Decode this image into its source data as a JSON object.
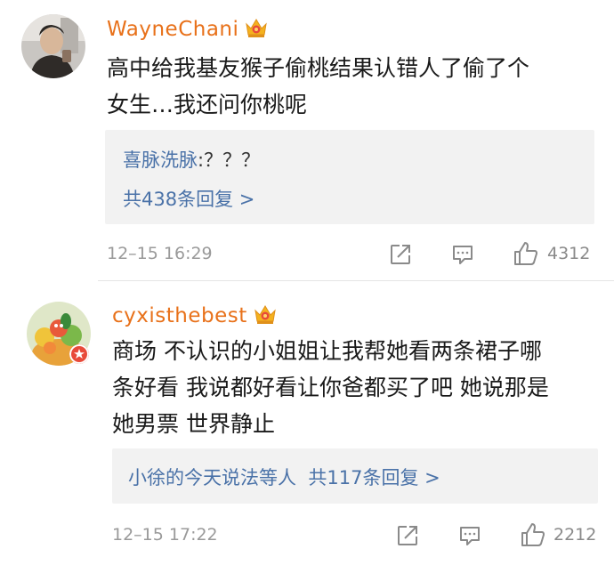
{
  "comments": [
    {
      "username": "WayneChani",
      "text": "高中给我基友猴子偷桃结果认错人了偷了个\n女生…我还问你桃呢",
      "reply_preview": {
        "author": "喜脉洗脉",
        "text": ":？？？"
      },
      "reply_count_label": "共438条回复 >",
      "timestamp": "12–15 16:29",
      "like_count": "4312",
      "icons": [
        "crown-icon",
        "share-icon",
        "comment-icon",
        "like-icon"
      ]
    },
    {
      "username": "cyxisthebest",
      "text": "商场 不认识的小姐姐让我帮她看两条裙子哪\n条好看 我说都好看让你爸都买了吧 她说那是\n她男票 世界静止",
      "reply_preview": {
        "summary": "小徐的今天说法等人",
        "count_label": "共117条回复 >"
      },
      "timestamp": "12–15 17:22",
      "like_count": "2212",
      "icons": [
        "crown-icon",
        "badge-icon",
        "share-icon",
        "comment-icon",
        "like-icon"
      ]
    }
  ],
  "colors": {
    "username": "#e8711a",
    "link": "#4a72a8",
    "body_text": "#1a1a1a",
    "meta": "#9a9a9a",
    "reply_background": "#f2f2f2",
    "badge": "#e84a3a"
  }
}
